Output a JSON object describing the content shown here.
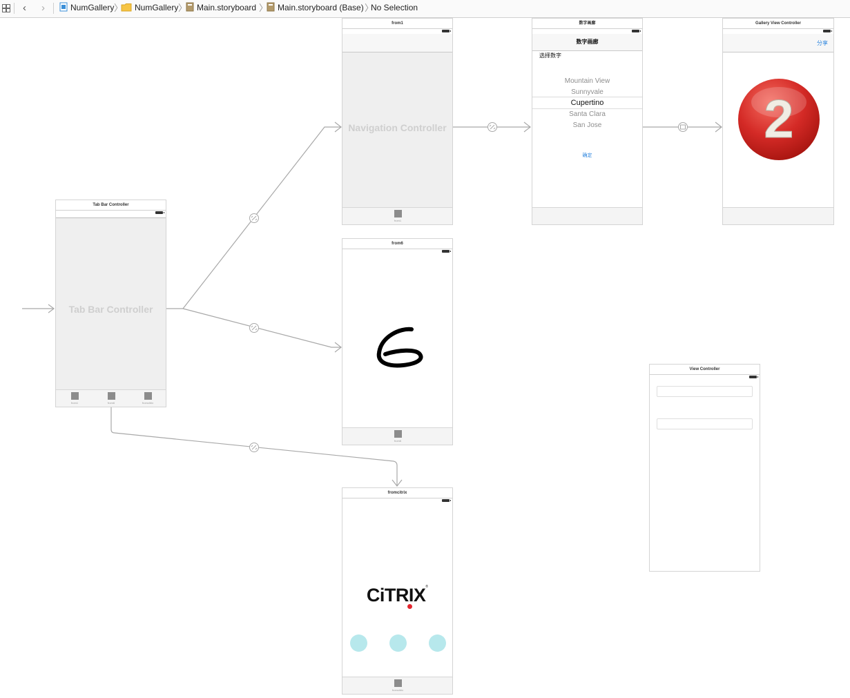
{
  "jumpbar": {
    "crumbs": [
      "NumGallery",
      "NumGallery",
      "Main.storyboard",
      "Main.storyboard (Base)",
      "No Selection"
    ]
  },
  "scenes": {
    "tabbar_controller": {
      "title": "Tab Bar Controller",
      "placeholder": "Tab Bar Controller",
      "tabs": [
        "from1",
        "from6",
        "fromcitrix"
      ]
    },
    "nav_controller": {
      "title": "from1",
      "placeholder": "Navigation Controller",
      "tab": "from1"
    },
    "number_gallery": {
      "title": "数字画廊",
      "nav_title": "数字画廊",
      "prompt": "选择数字",
      "picker": [
        "Mountain View",
        "Sunnyvale",
        "Cupertino",
        "Santa Clara",
        "San Jose"
      ],
      "picker_selected": "Cupertino",
      "confirm": "确定"
    },
    "gallery_vc": {
      "title": "Gallery View Controller",
      "share": "分享",
      "badge_number": "2"
    },
    "from6": {
      "title": "from6",
      "digit": "6",
      "tab": "from6"
    },
    "fromcitrix": {
      "title": "fromcitrix",
      "logo": "CiTRIX",
      "tab": "fromcitrix"
    },
    "view_controller": {
      "title": "View Controller"
    }
  },
  "colors": {
    "accent": "#2e86de",
    "badge_red": "#d42a26",
    "circle_cyan": "#b7e8ec",
    "citrix_dot": "#e3262e"
  }
}
